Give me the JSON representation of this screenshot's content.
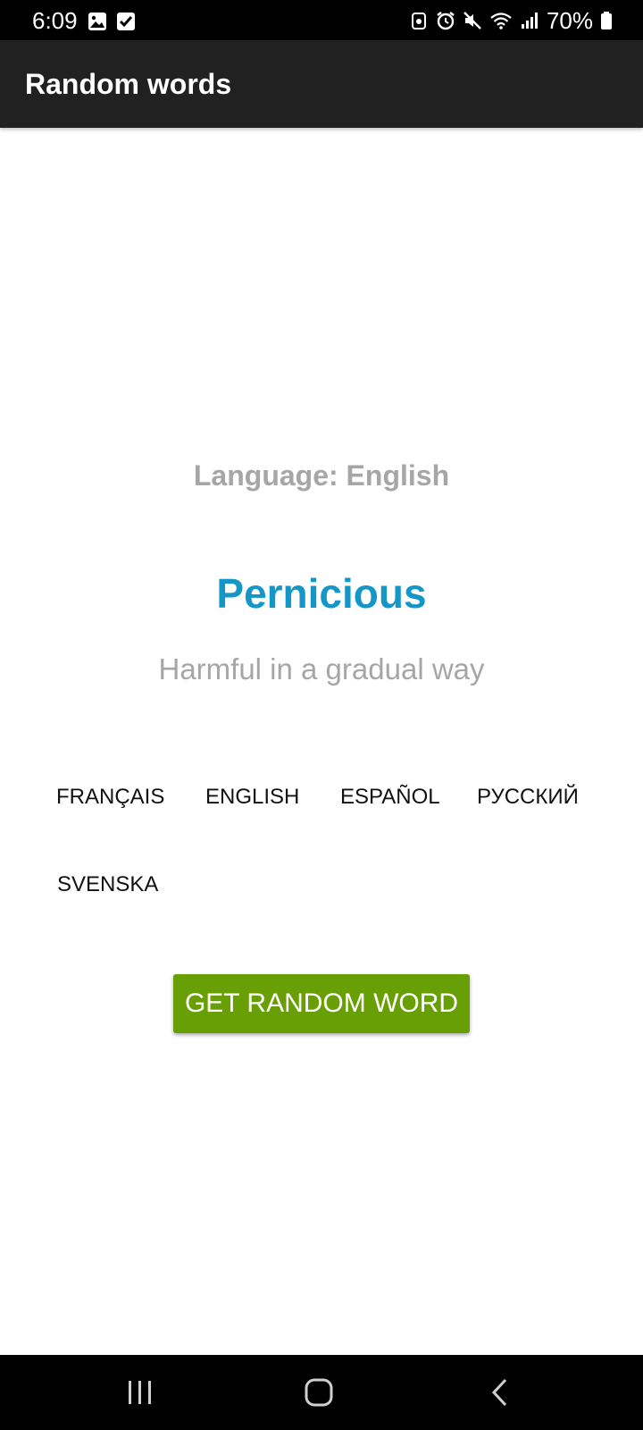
{
  "status_bar": {
    "time": "6:09",
    "battery_text": "70%",
    "left_icons": [
      "gallery-icon",
      "checkbox-icon"
    ],
    "right_icons": [
      "data-saver-icon",
      "alarm-icon",
      "mute-icon",
      "wifi-icon",
      "signal-icon",
      "battery-icon"
    ]
  },
  "app_bar": {
    "title": "Random words"
  },
  "main": {
    "language_label": "Language: English",
    "word": "Pernicious",
    "definition": "Harmful in a gradual way",
    "languages": [
      "FRANÇAIS",
      "ENGLISH",
      "ESPAÑOL",
      "РУССКИЙ",
      "SVENSKA"
    ],
    "get_button_label": "GET RANDOM WORD"
  },
  "nav_bar": {
    "buttons": [
      "recent-apps-icon",
      "home-icon",
      "back-icon"
    ]
  },
  "colors": {
    "app_bar": "#212121",
    "word": "#1497c6",
    "muted_text": "#a6a6a6",
    "button": "#689f04"
  }
}
